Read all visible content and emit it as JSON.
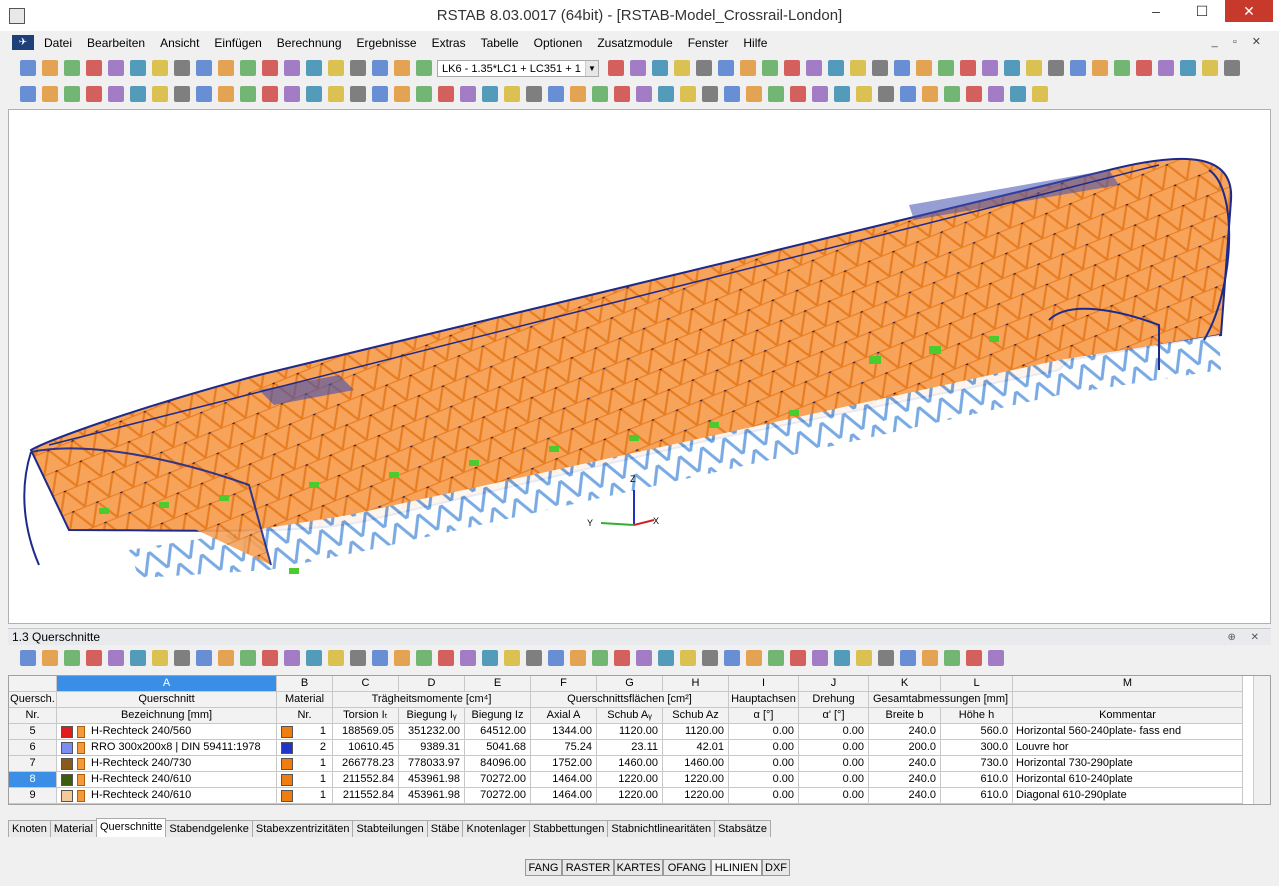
{
  "window": {
    "title": "RSTAB 8.03.0017 (64bit) - [RSTAB-Model_Crossrail-London]",
    "minimize": "–",
    "maximize": "☐",
    "close": "✕"
  },
  "menu": {
    "logo": "✈",
    "items": [
      "Datei",
      "Bearbeiten",
      "Ansicht",
      "Einfügen",
      "Berechnung",
      "Ergebnisse",
      "Extras",
      "Tabelle",
      "Optionen",
      "Zusatzmodule",
      "Fenster",
      "Hilfe"
    ],
    "mdi_controls": "_ ▫ ✕"
  },
  "toolbar": {
    "load_case": "LK6 - 1.35*LC1 + LC351 + 1"
  },
  "viewport": {
    "axis_z": "Z",
    "axis_y": "Y",
    "axis_x": "X"
  },
  "panel": {
    "title": "1.3 Querschnitte",
    "pin": "⊕ ✕"
  },
  "table": {
    "col_letters": [
      "A",
      "B",
      "C",
      "D",
      "E",
      "F",
      "G",
      "H",
      "I",
      "J",
      "K",
      "L",
      "M"
    ],
    "row_header_label": "Quersch.",
    "row_header_sub": "Nr.",
    "group_headers": {
      "A": "Querschnitt",
      "B": "Material",
      "CE": "Trägheitsmomente [cm⁴]",
      "FH": "Querschnittsflächen [cm²]",
      "I": "Hauptachsen",
      "J": "Drehung",
      "KL": "Gesamtabmessungen [mm]",
      "M": ""
    },
    "sub_headers": [
      "Bezeichnung [mm]",
      "Nr.",
      "Torsion Iₜ",
      "Biegung Iᵧ",
      "Biegung Iz",
      "Axial A",
      "Schub Aᵧ",
      "Schub Az",
      "α [°]",
      "α' [°]",
      "Breite b",
      "Höhe h",
      "Kommentar"
    ],
    "rows": [
      {
        "nr": "5",
        "name": "H-Rechteck 240/560",
        "color": "#e31b1b",
        "mat": "1",
        "matcolor": "#f07d10",
        "c": "188569.05",
        "d": "351232.00",
        "e": "64512.00",
        "f": "1344.00",
        "g": "1120.00",
        "h": "1120.00",
        "i": "0.00",
        "j": "0.00",
        "k": "240.0",
        "l": "560.0",
        "m": "Horizontal 560-240plate- fass end"
      },
      {
        "nr": "6",
        "name": "RRO 300x200x8 | DIN 59411:1978",
        "color": "#7c8df0",
        "mat": "2",
        "matcolor": "#2136c8",
        "c": "10610.45",
        "d": "9389.31",
        "e": "5041.68",
        "f": "75.24",
        "g": "23.11",
        "h": "42.01",
        "i": "0.00",
        "j": "0.00",
        "k": "200.0",
        "l": "300.0",
        "m": "Louvre hor"
      },
      {
        "nr": "7",
        "name": "H-Rechteck 240/730",
        "color": "#8a5a1a",
        "mat": "1",
        "matcolor": "#f07d10",
        "c": "266778.23",
        "d": "778033.97",
        "e": "84096.00",
        "f": "1752.00",
        "g": "1460.00",
        "h": "1460.00",
        "i": "0.00",
        "j": "0.00",
        "k": "240.0",
        "l": "730.0",
        "m": "Horizontal 730-290plate"
      },
      {
        "nr": "8",
        "name": "H-Rechteck 240/610",
        "color": "#3d5c10",
        "mat": "1",
        "matcolor": "#f07d10",
        "c": "211552.84",
        "d": "453961.98",
        "e": "70272.00",
        "f": "1464.00",
        "g": "1220.00",
        "h": "1220.00",
        "i": "0.00",
        "j": "0.00",
        "k": "240.0",
        "l": "610.0",
        "m": "Horizontal 610-240plate"
      },
      {
        "nr": "9",
        "name": "H-Rechteck 240/610",
        "color": "#f4c89a",
        "mat": "1",
        "matcolor": "#f07d10",
        "c": "211552.84",
        "d": "453961.98",
        "e": "70272.00",
        "f": "1464.00",
        "g": "1220.00",
        "h": "1220.00",
        "i": "0.00",
        "j": "0.00",
        "k": "240.0",
        "l": "610.0",
        "m": "Diagonal 610-290plate"
      }
    ]
  },
  "tabs": [
    "Knoten",
    "Material",
    "Querschnitte",
    "Stabendgelenke",
    "Stabexzentrizitäten",
    "Stabteilungen",
    "Stäbe",
    "Knotenlager",
    "Stabbettungen",
    "Stabnichtlinearitäten",
    "Stabsätze"
  ],
  "active_tab": "Querschnitte",
  "status": [
    "FANG",
    "RASTER",
    "KARTES",
    "OFANG",
    "HLINIEN",
    "DXF"
  ]
}
